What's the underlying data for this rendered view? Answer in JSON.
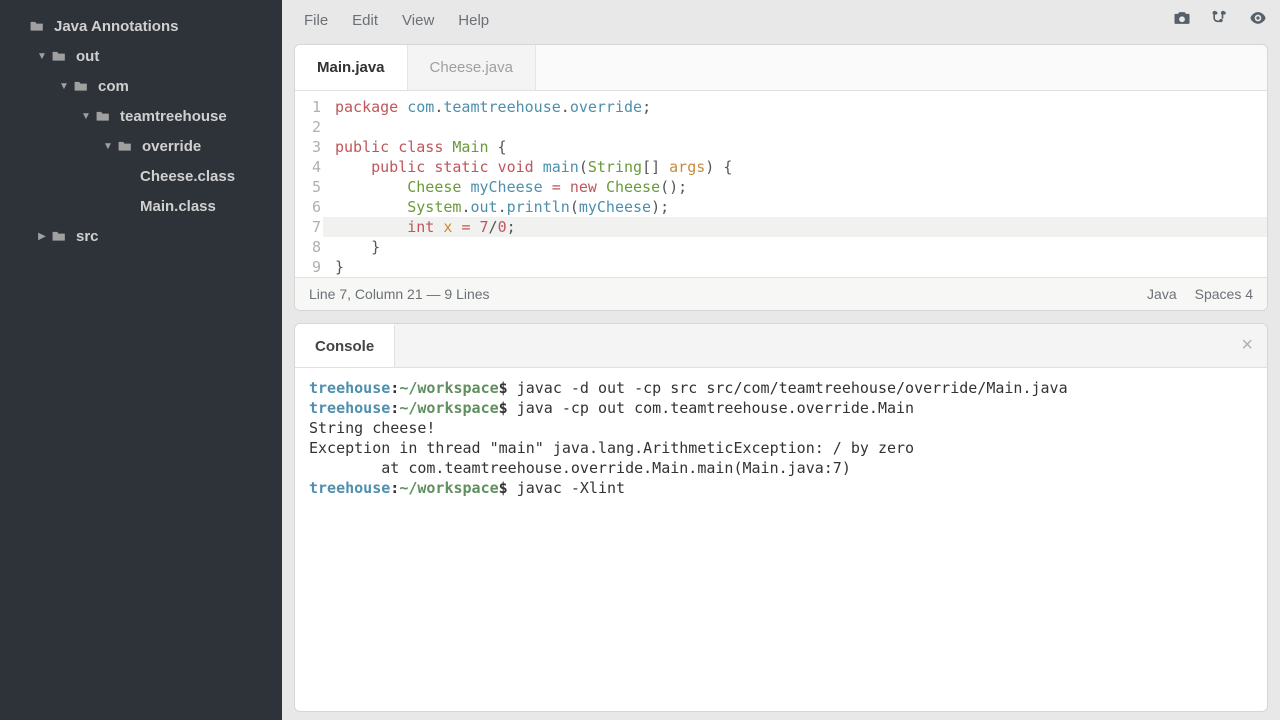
{
  "sidebar": {
    "items": [
      {
        "label": "Java Annotations",
        "depth": 0,
        "arrow": "",
        "kind": "folder-open"
      },
      {
        "label": "out",
        "depth": 1,
        "arrow": "▼",
        "kind": "folder"
      },
      {
        "label": "com",
        "depth": 2,
        "arrow": "▼",
        "kind": "folder"
      },
      {
        "label": "teamtreehouse",
        "depth": 3,
        "arrow": "▼",
        "kind": "folder"
      },
      {
        "label": "override",
        "depth": 4,
        "arrow": "▼",
        "kind": "folder"
      },
      {
        "label": "Cheese.class",
        "depth": 5,
        "arrow": "",
        "kind": "file"
      },
      {
        "label": "Main.class",
        "depth": 5,
        "arrow": "",
        "kind": "file"
      },
      {
        "label": "src",
        "depth": 1,
        "arrow": "▶",
        "kind": "folder"
      }
    ]
  },
  "menu": {
    "items": [
      "File",
      "Edit",
      "View",
      "Help"
    ]
  },
  "tabs": [
    {
      "label": "Main.java",
      "active": true
    },
    {
      "label": "Cheese.java",
      "active": false
    }
  ],
  "code": {
    "highlight_line": 7,
    "tokens": [
      [
        [
          "kw",
          "package"
        ],
        [
          "pn",
          " "
        ],
        [
          "nm",
          "com"
        ],
        [
          "pn",
          "."
        ],
        [
          "nm",
          "teamtreehouse"
        ],
        [
          "pn",
          "."
        ],
        [
          "nm",
          "override"
        ],
        [
          "pn",
          ";"
        ]
      ],
      [],
      [
        [
          "kw",
          "public"
        ],
        [
          "pn",
          " "
        ],
        [
          "kw",
          "class"
        ],
        [
          "pn",
          " "
        ],
        [
          "cls",
          "Main"
        ],
        [
          "pn",
          " {"
        ]
      ],
      [
        [
          "pn",
          "    "
        ],
        [
          "kw",
          "public"
        ],
        [
          "pn",
          " "
        ],
        [
          "kw",
          "static"
        ],
        [
          "pn",
          " "
        ],
        [
          "kw",
          "void"
        ],
        [
          "pn",
          " "
        ],
        [
          "fn",
          "main"
        ],
        [
          "pn",
          "("
        ],
        [
          "cls",
          "String"
        ],
        [
          "pn",
          "[] "
        ],
        [
          "id",
          "args"
        ],
        [
          "pn",
          ") {"
        ]
      ],
      [
        [
          "pn",
          "        "
        ],
        [
          "cls",
          "Cheese"
        ],
        [
          "pn",
          " "
        ],
        [
          "nm",
          "myCheese"
        ],
        [
          "pn",
          " "
        ],
        [
          "op",
          "="
        ],
        [
          "pn",
          " "
        ],
        [
          "kw",
          "new"
        ],
        [
          "pn",
          " "
        ],
        [
          "cls",
          "Cheese"
        ],
        [
          "pn",
          "();"
        ]
      ],
      [
        [
          "pn",
          "        "
        ],
        [
          "cls",
          "System"
        ],
        [
          "pn",
          "."
        ],
        [
          "nm",
          "out"
        ],
        [
          "pn",
          "."
        ],
        [
          "fn",
          "println"
        ],
        [
          "pn",
          "("
        ],
        [
          "nm",
          "myCheese"
        ],
        [
          "pn",
          ");"
        ]
      ],
      [
        [
          "pn",
          "        "
        ],
        [
          "decl",
          "int"
        ],
        [
          "pn",
          " "
        ],
        [
          "id",
          "x"
        ],
        [
          "pn",
          " "
        ],
        [
          "op",
          "="
        ],
        [
          "pn",
          " "
        ],
        [
          "num",
          "7"
        ],
        [
          "pn",
          "/"
        ],
        [
          "num",
          "0"
        ],
        [
          "pn",
          ";"
        ]
      ],
      [
        [
          "pn",
          "    }"
        ]
      ],
      [
        [
          "pn",
          "}"
        ]
      ]
    ]
  },
  "status": {
    "left": "Line 7, Column 21 — 9 Lines",
    "lang": "Java",
    "indent": "Spaces 4"
  },
  "console": {
    "title": "Console",
    "prompt_host": "treehouse",
    "prompt_sep1": ":",
    "prompt_path": "~/workspace",
    "prompt_sep2": "$",
    "lines": [
      {
        "type": "cmd",
        "text": " javac -d out -cp src src/com/teamtreehouse/override/Main.java"
      },
      {
        "type": "cmd",
        "text": " java -cp out com.teamtreehouse.override.Main"
      },
      {
        "type": "out",
        "text": "String cheese!"
      },
      {
        "type": "out",
        "text": "Exception in thread \"main\" java.lang.ArithmeticException: / by zero"
      },
      {
        "type": "out",
        "text": "        at com.teamtreehouse.override.Main.main(Main.java:7)"
      },
      {
        "type": "cmd",
        "text": " javac -Xlint"
      }
    ]
  }
}
